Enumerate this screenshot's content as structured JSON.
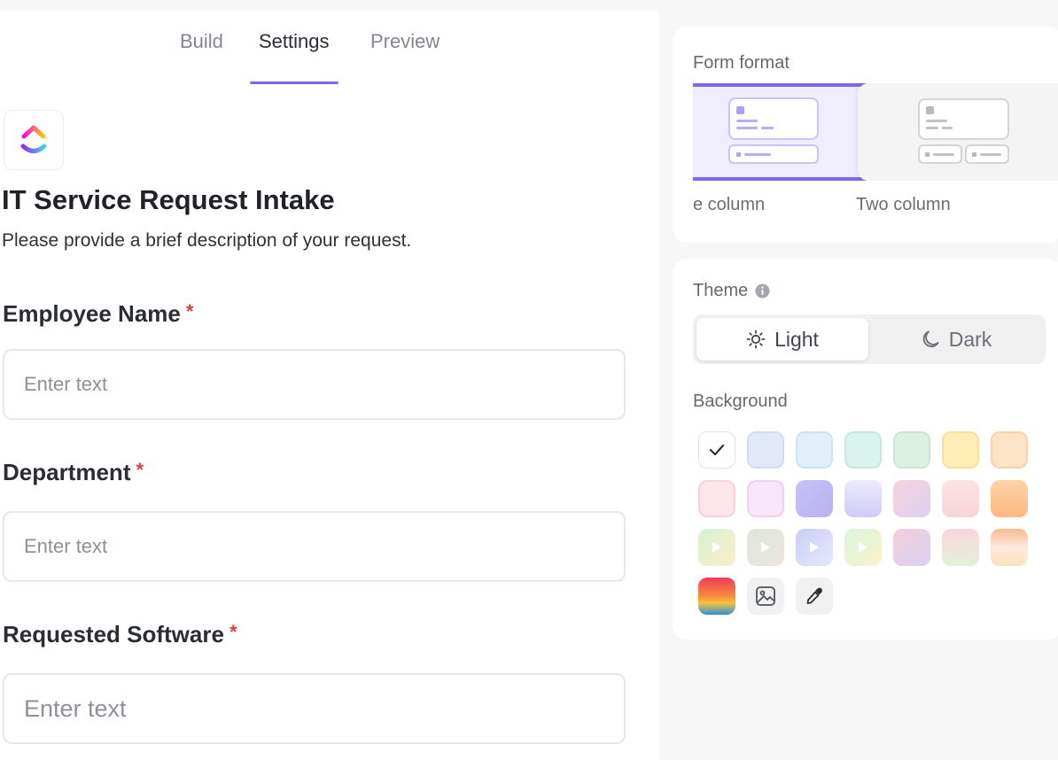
{
  "tabs": [
    {
      "label": "Build"
    },
    {
      "label": "Settings",
      "active": true
    },
    {
      "label": "Preview"
    }
  ],
  "form": {
    "title": "IT Service Request Intake",
    "description": "Please provide a brief description of your request.",
    "required_marker": "*",
    "fields": [
      {
        "label": "Employee Name",
        "placeholder": "Enter text"
      },
      {
        "label": "Department",
        "placeholder": "Enter text"
      },
      {
        "label": "Requested Software",
        "placeholder": "Enter text"
      }
    ]
  },
  "form_format": {
    "label": "Form format",
    "options": [
      {
        "label": "e column",
        "selected": true
      },
      {
        "label": "Two column"
      }
    ]
  },
  "theme": {
    "label": "Theme",
    "info_icon": "info-icon",
    "options": [
      {
        "label": "Light",
        "icon": "sun-icon",
        "selected": true
      },
      {
        "label": "Dark",
        "icon": "moon-icon"
      }
    ]
  },
  "background": {
    "label": "Background",
    "selected_index": 0,
    "colors": {
      "accent": "#7b68ee",
      "required": "#d93f3f"
    }
  }
}
